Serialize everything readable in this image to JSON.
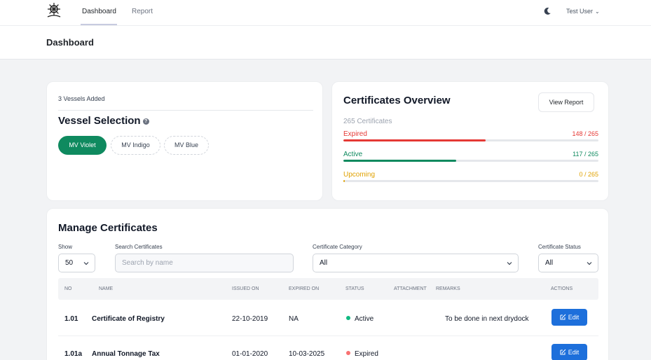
{
  "header": {
    "logo_icon": "ship-wheel-icon",
    "tabs": [
      {
        "label": "Dashboard",
        "active": true
      },
      {
        "label": "Report",
        "active": false
      }
    ],
    "theme_icon": "moon-icon",
    "user_name": "Test User"
  },
  "page": {
    "title": "Dashboard"
  },
  "vessels": {
    "added_text": "3 Vessels Added",
    "title": "Vessel Selection",
    "items": [
      {
        "label": "MV Violet",
        "selected": true
      },
      {
        "label": "MV Indigo",
        "selected": false
      },
      {
        "label": "MV Blue",
        "selected": false
      }
    ]
  },
  "overview": {
    "title": "Certificates Overview",
    "view_report_label": "View Report",
    "total_text": "265 Certificates",
    "rows": [
      {
        "label": "Expired",
        "value_text": "148 / 265",
        "fraction": 0.558,
        "color": "#e53935"
      },
      {
        "label": "Active",
        "value_text": "117 / 265",
        "fraction": 0.442,
        "color": "#0f8a5f"
      },
      {
        "label": "Upcoming",
        "value_text": "0 / 265",
        "fraction": 0.0,
        "color": "#e0a100"
      }
    ]
  },
  "manage": {
    "title": "Manage Certificates",
    "show_label": "Show",
    "show_value": "50",
    "search_label": "Search Certificates",
    "search_placeholder": "Search by name",
    "category_label": "Certificate Category",
    "category_value": "All",
    "status_label": "Certificate Status",
    "status_value": "All",
    "columns": [
      "NO",
      "NAME",
      "ISSUED ON",
      "EXPIRED ON",
      "STATUS",
      "ATTACHMENT",
      "REMARKS",
      "ACTIONS"
    ],
    "rows": [
      {
        "no": "1.01",
        "name": "Certificate of Registry",
        "issued": "22-10-2019",
        "expired": "NA",
        "status": "Active",
        "status_color": "#10b981",
        "remarks": "To be done in next drydock",
        "action": "Edit"
      },
      {
        "no": "1.01a",
        "name": "Annual Tonnage Tax",
        "issued": "01-01-2020",
        "expired": "10-03-2025",
        "status": "Expired",
        "status_color": "#f87171",
        "remarks": "",
        "action": "Edit"
      }
    ]
  }
}
